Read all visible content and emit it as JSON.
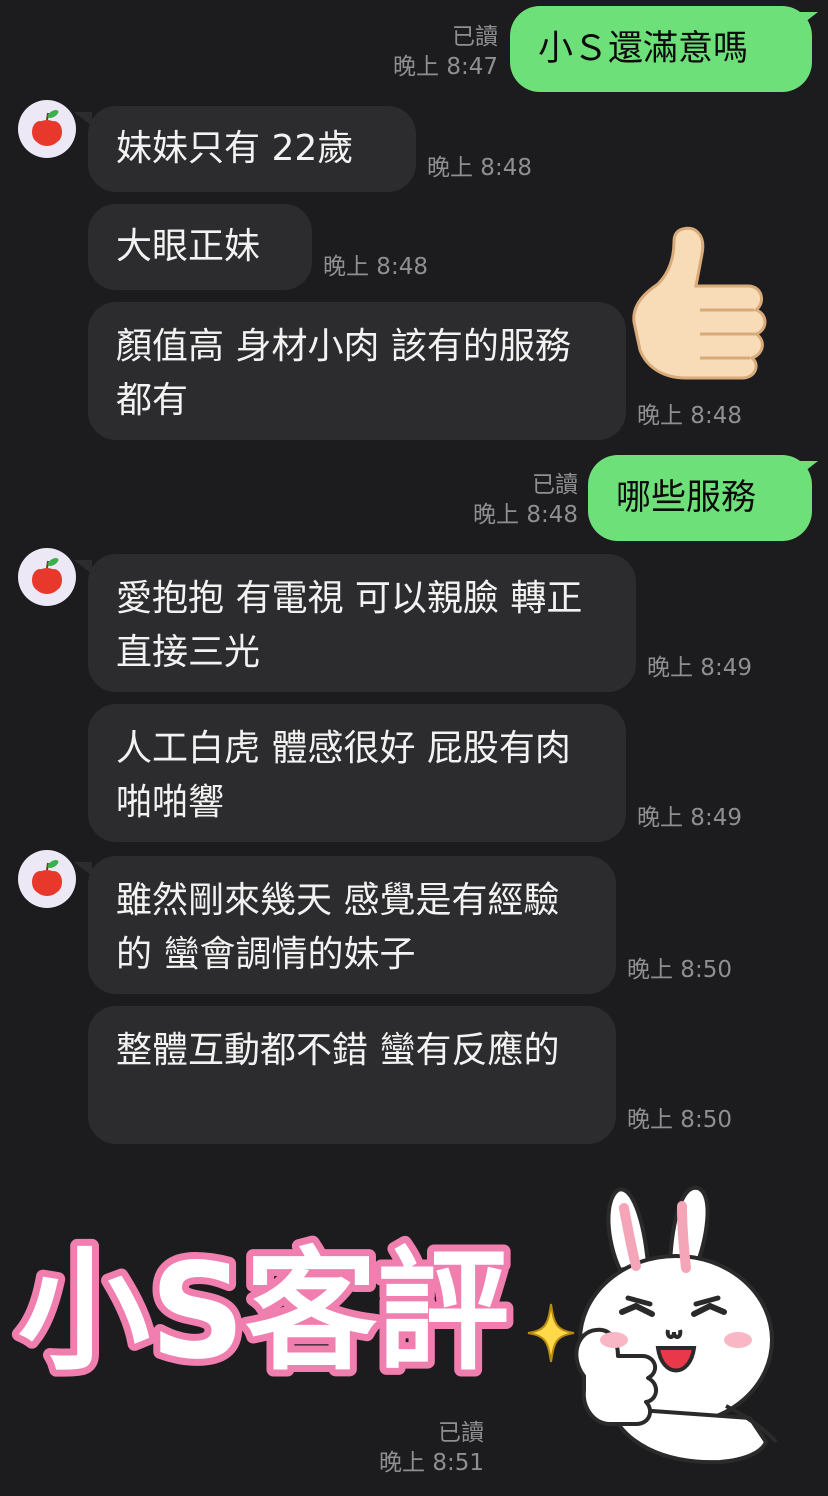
{
  "messages": [
    {
      "dir": "out",
      "text": "小Ｓ還滿意嗎",
      "read": "已讀",
      "time": "晚上 8:47"
    },
    {
      "dir": "in",
      "text": "妹妹只有 22歲",
      "time": "晚上 8:48"
    },
    {
      "dir": "in",
      "text": "大眼正妹",
      "time": "晚上 8:48"
    },
    {
      "dir": "in",
      "text": "顏值高 身材小肉 該有的服務都有",
      "time": "晚上 8:48"
    },
    {
      "dir": "out",
      "text": "哪些服務",
      "read": "已讀",
      "time": "晚上 8:48"
    },
    {
      "dir": "in",
      "text": "愛抱抱 有電視 可以親臉 轉正直接三光",
      "time": "晚上 8:49"
    },
    {
      "dir": "in",
      "text": "人工白虎 體感很好 屁股有肉 啪啪響",
      "time": "晚上 8:49"
    },
    {
      "dir": "in",
      "text": "雖然剛來幾天 感覺是有經驗的 蠻會調情的妹子",
      "time": "晚上 8:50"
    },
    {
      "dir": "in",
      "text": "整體互動都不錯 蠻有反應的",
      "time": "晚上 8:50"
    }
  ],
  "sticker_thumbs": {
    "icon": "thumbs-up-emoji"
  },
  "sticker_bunny": {
    "caption": "小S客評",
    "icon": "bunny-thumbs-up-sticker",
    "read": "已讀",
    "time": "晚上 8:51"
  },
  "avatar": {
    "icon": "apple-icon"
  },
  "colors": {
    "background": "#1c1c1e",
    "outgoing": "#6ee07a",
    "incoming": "#2c2c2e",
    "meta": "#8e8e93",
    "caption_fill": "#ffffff",
    "caption_outline": "#f07fb0"
  }
}
